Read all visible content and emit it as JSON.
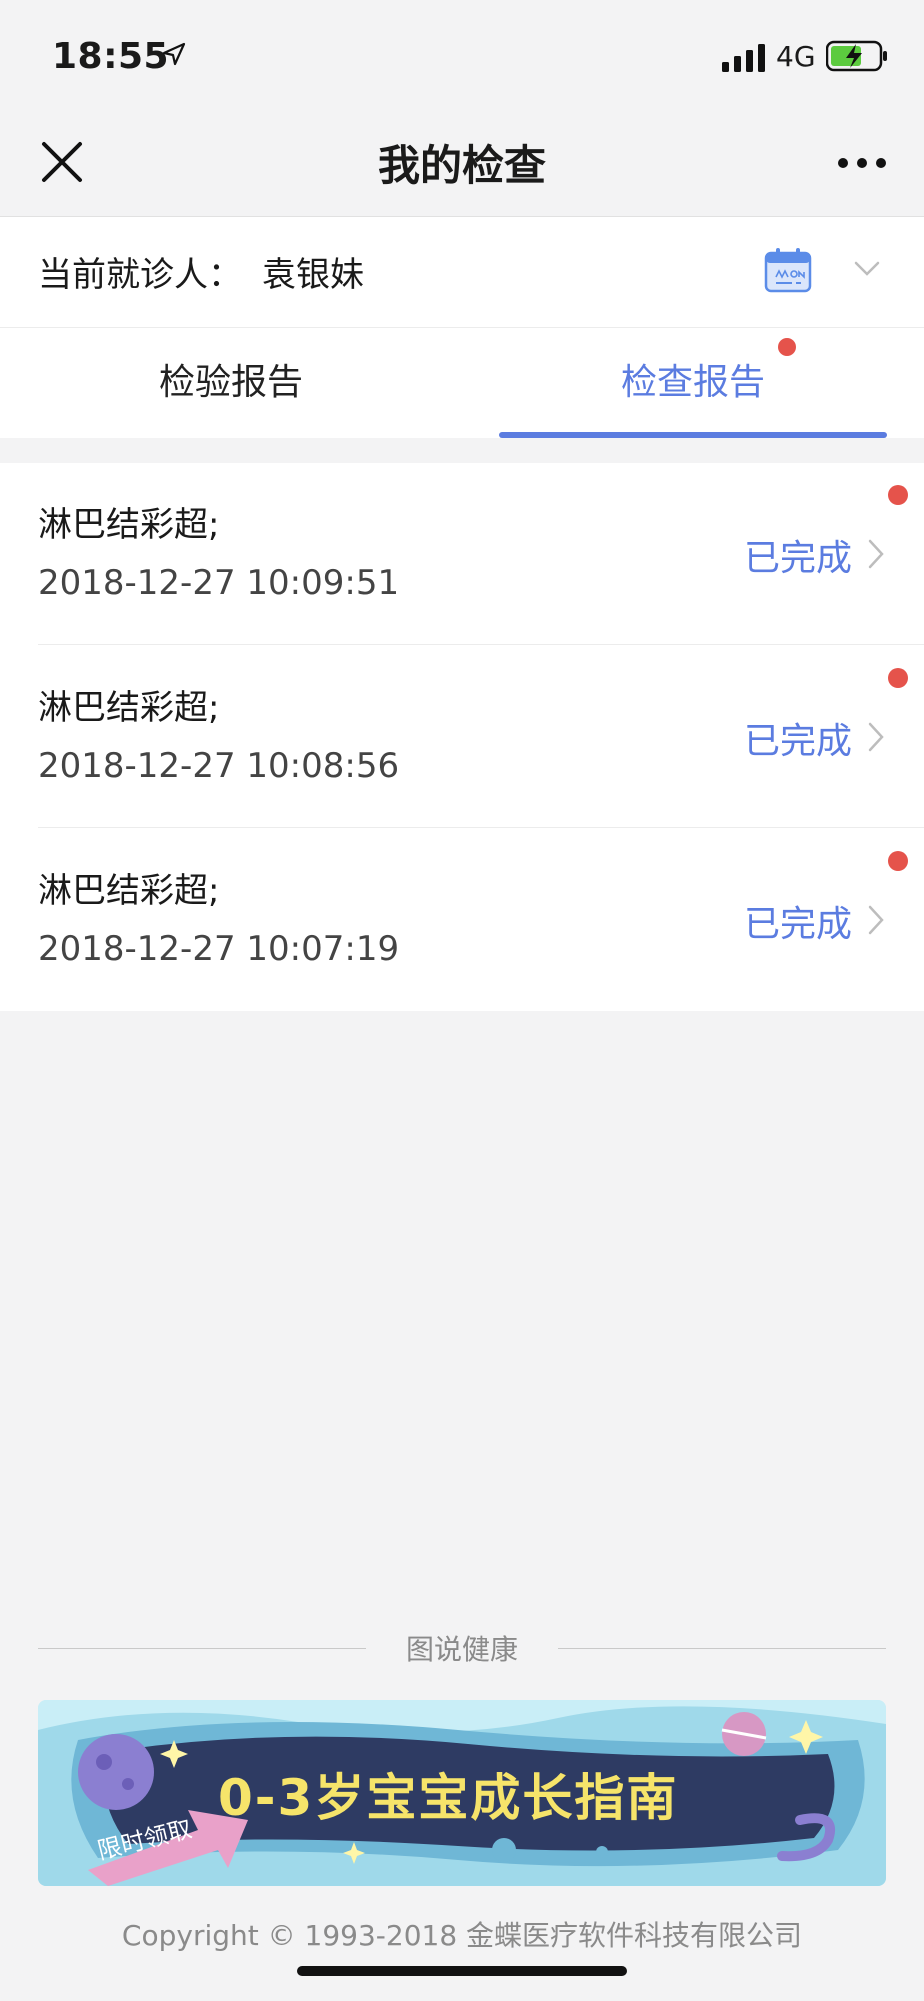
{
  "status_bar": {
    "time": "18:55",
    "network": "4G"
  },
  "header": {
    "title": "我的检查"
  },
  "patient": {
    "label": "当前就诊人：",
    "name": "袁银妹"
  },
  "tabs": [
    {
      "label": "检验报告",
      "active": false
    },
    {
      "label": "检查报告",
      "active": true,
      "has_badge": true
    }
  ],
  "reports": [
    {
      "name": "淋巴结彩超;",
      "datetime": "2018-12-27 10:09:51",
      "status": "已完成",
      "unread": true
    },
    {
      "name": "淋巴结彩超;",
      "datetime": "2018-12-27 10:08:56",
      "status": "已完成",
      "unread": true
    },
    {
      "name": "淋巴结彩超;",
      "datetime": "2018-12-27 10:07:19",
      "status": "已完成",
      "unread": true
    }
  ],
  "section": {
    "title": "图说健康"
  },
  "banner": {
    "headline": "0-3岁宝宝成长指南",
    "tag": "限时领取"
  },
  "footer": {
    "copyright": "Copyright © 1993-2018 金蝶医疗软件科技有限公司"
  },
  "colors": {
    "accent": "#5b7ce0",
    "badge": "#e5534b",
    "background": "#f3f3f4"
  }
}
